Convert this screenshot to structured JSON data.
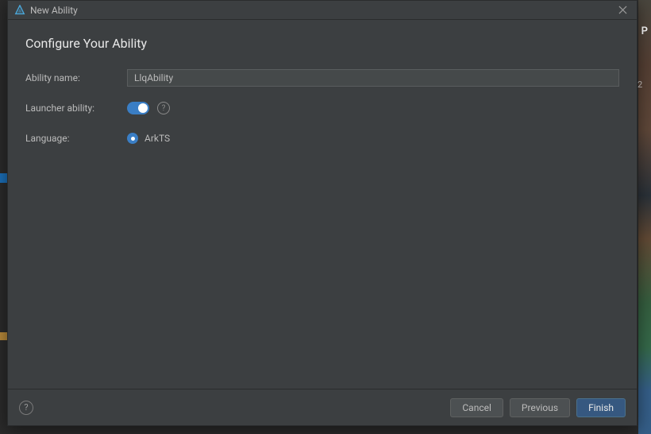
{
  "window": {
    "title": "New Ability"
  },
  "heading": "Configure Your Ability",
  "fields": {
    "ability_name": {
      "label": "Ability name:",
      "value": "LlqAbility"
    },
    "launcher_ability": {
      "label": "Launcher ability:",
      "enabled": true
    },
    "language": {
      "label": "Language:",
      "options": [
        {
          "label": "ArkTS",
          "selected": true
        }
      ]
    }
  },
  "footer": {
    "cancel_label": "Cancel",
    "previous_label": "Previous",
    "finish_label": "Finish"
  },
  "bg": {
    "char": "P",
    "num": "2"
  },
  "colors": {
    "accent": "#3a7ec5",
    "panel": "#3c3f41",
    "input": "#45494a",
    "primary_btn": "#365880"
  }
}
